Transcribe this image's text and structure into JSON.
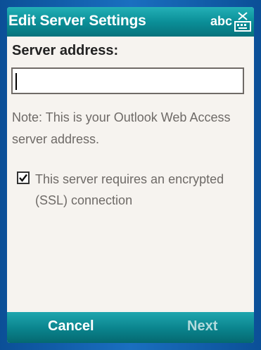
{
  "window": {
    "title": "Edit Server Settings",
    "input_mode": "abc",
    "input_mode_icon": "keyboard-icon"
  },
  "form": {
    "server_address_label": "Server address:",
    "server_address_value": "",
    "note": "Note: This is your Outlook Web Access server address.",
    "ssl_checkbox_label": "This server requires an encrypted (SSL) connection",
    "ssl_checked": true
  },
  "softkeys": {
    "left": "Cancel",
    "right": "Next"
  },
  "colors": {
    "titlebar": "#0b8f98",
    "frame": "#0d58a4",
    "screen_bg": "#f6f3ef",
    "note_text": "#6e6a67"
  }
}
